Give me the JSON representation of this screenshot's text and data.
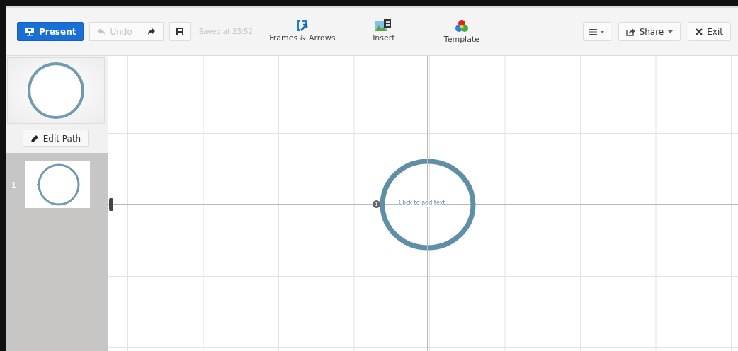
{
  "toolbar": {
    "present": {
      "label": "Present"
    },
    "undo": {
      "label": "Undo",
      "disabled": true
    },
    "redo": {
      "disabled": false
    },
    "saved": "Saved at 23:52",
    "tools": [
      {
        "kind": "frames",
        "label": "Frames & Arrows"
      },
      {
        "kind": "insert",
        "label": "Insert"
      },
      {
        "kind": "template",
        "label": "Template"
      }
    ],
    "share": {
      "label": "Share"
    },
    "exit": {
      "label": "Exit"
    }
  },
  "sidebar": {
    "edit_path": {
      "label": "Edit Path"
    },
    "slides": [
      {
        "number": "1",
        "selected": true
      }
    ]
  },
  "canvas": {
    "frame": {
      "text": "Click to add text",
      "step": "1"
    }
  }
}
